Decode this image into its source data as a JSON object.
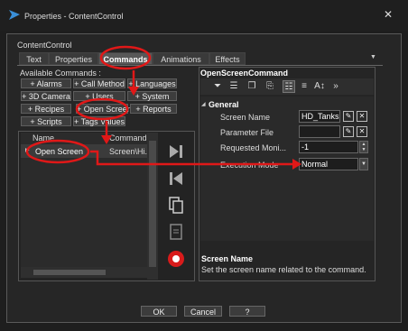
{
  "window": {
    "title": "Properties - ContentControl"
  },
  "object_name": "ContentControl",
  "tabs": [
    {
      "label": "Text"
    },
    {
      "label": "Properties"
    },
    {
      "label": "Commands"
    },
    {
      "label": "Animations"
    },
    {
      "label": "Effects"
    }
  ],
  "available_label": "Available Commands :",
  "commands": {
    "alarms": "+ Alarms",
    "call_method": "+ Call Method",
    "languages": "+ Languages",
    "camera": "+ 3D Camera",
    "users": "+ Users",
    "system": "+ System",
    "recipes": "+ Recipes",
    "open_screen": "+ Open Screen",
    "reports": "+ Reports",
    "scripts": "+ Scripts",
    "tags_values": "+ Tags Values"
  },
  "list": {
    "columns": [
      "Name",
      "Command"
    ],
    "rows": [
      {
        "name": "Open Screen",
        "command": "Screen\\Hi..."
      }
    ]
  },
  "command_panel": {
    "title": "OpenScreenCommand",
    "group": "General",
    "properties": [
      {
        "label": "Screen Name",
        "value": "HD_Tanks"
      },
      {
        "label": "Parameter File",
        "value": ""
      },
      {
        "label": "Requested Moni...",
        "value": "-1"
      },
      {
        "label": "Execution Mode",
        "value": "Normal"
      }
    ]
  },
  "description": {
    "title": "Screen Name",
    "text": "Set the screen name related to the command."
  },
  "buttons": {
    "ok": "OK",
    "cancel": "Cancel",
    "help": "?"
  },
  "colors": {
    "annotation": "#e01818",
    "selected_tab": "#585858"
  }
}
